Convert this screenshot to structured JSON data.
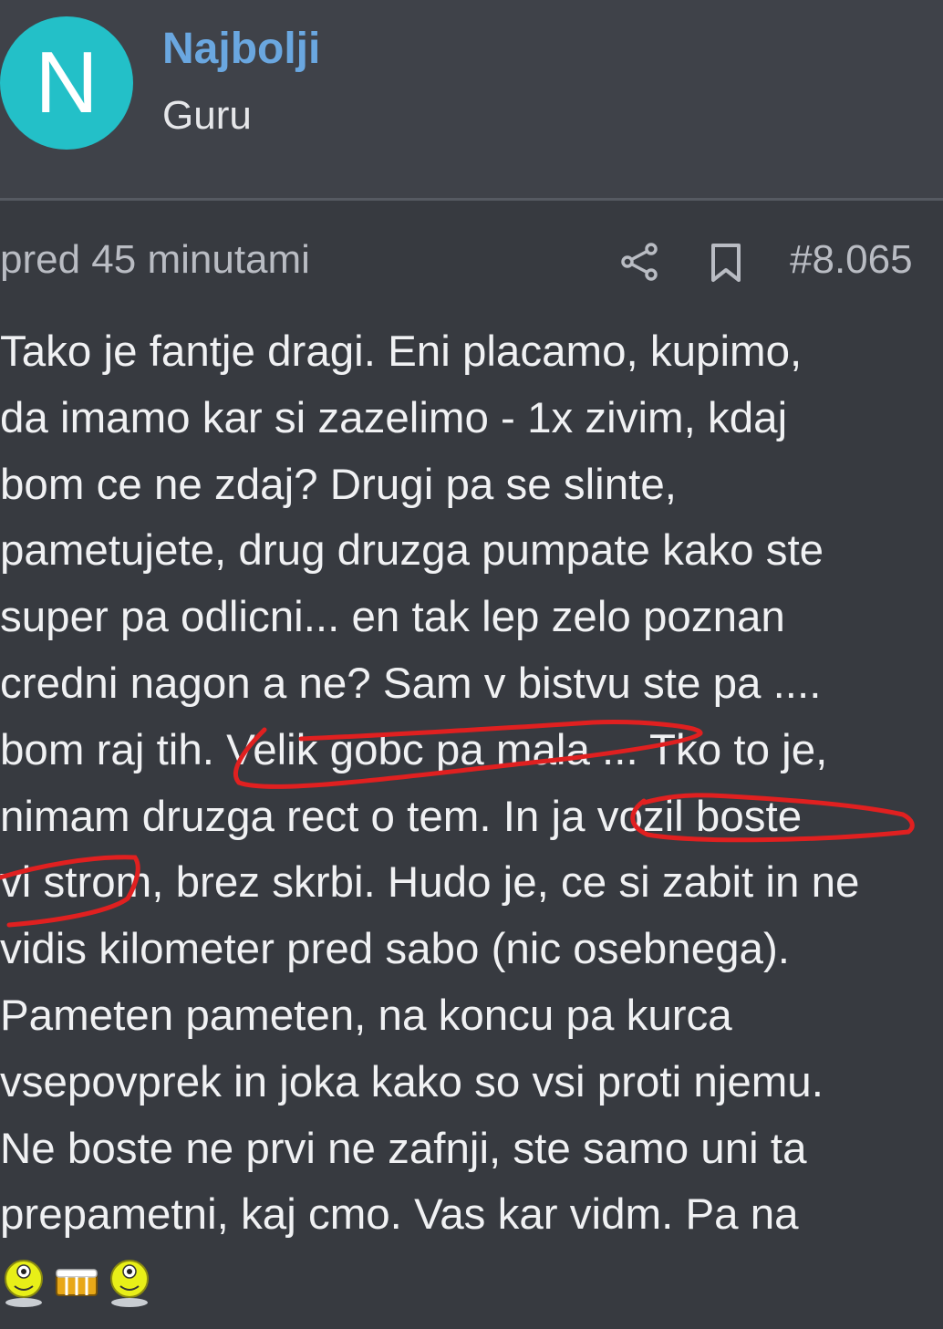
{
  "author": {
    "avatar_letter": "N",
    "name": "Najbolji",
    "rank": "Guru"
  },
  "post": {
    "time": "pred 45 minutami",
    "number": "#8.065",
    "body": "Tako je fantje dragi. Eni placamo, kupimo,\nda imamo kar si zazelimo - 1x zivim, kdaj\nbom ce ne zdaj? Drugi pa se slinte,\npametujete, drug druzga pumpate kako ste\nsuper pa odlicni... en tak lep zelo poznan\ncredni nagon a ne? Sam v bistvu ste pa ....\nbom raj tih. Velik gobc pa mala ... Tko to je,\nnimam druzga rect o tem. In ja vozil boste\nvi strom, brez skrbi. Hudo je, ce si zabit in ne\nvidis kilometer pred sabo (nic osebnega).\nPameten pameten, na koncu pa kurca\nvsepovprek in joka kako so vsi proti njemu.\nNe boste ne prvi ne zafnji, ste samo uni ta\nprepametni, kaj cmo. Vas kar vidm. Pa na"
  },
  "icons": {
    "share": "share-icon",
    "bookmark": "bookmark-icon",
    "emojis": [
      "smiley-emoji",
      "beer-emoji",
      "smiley-emoji"
    ]
  },
  "colors": {
    "background": "#373a40",
    "header_background": "#3f4249",
    "avatar": "#23c0c8",
    "username": "#6aa7e0",
    "annotation_marker": "#e02020"
  }
}
